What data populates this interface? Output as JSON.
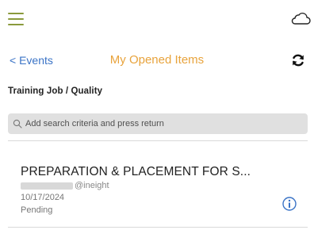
{
  "topbar": {
    "menu_icon": "hamburger-menu-icon",
    "cloud_icon": "cloud-icon"
  },
  "nav": {
    "back_label": "< Events",
    "title": "My Opened Items",
    "refresh_icon": "refresh-icon"
  },
  "section_title": "Training Job / Quality",
  "search": {
    "placeholder": "Add search criteria and press return",
    "value": "",
    "icon": "search-icon"
  },
  "items": [
    {
      "title": "PREPARATION & PLACEMENT FOR S...",
      "email_suffix": "@ineight",
      "date": "10/17/2024",
      "status": "Pending",
      "info_icon": "info-icon"
    }
  ],
  "colors": {
    "accent_green": "#8a9a3c",
    "link_blue": "#3a73c6",
    "title_orange": "#e8a33c",
    "info_blue": "#3a73c6"
  }
}
